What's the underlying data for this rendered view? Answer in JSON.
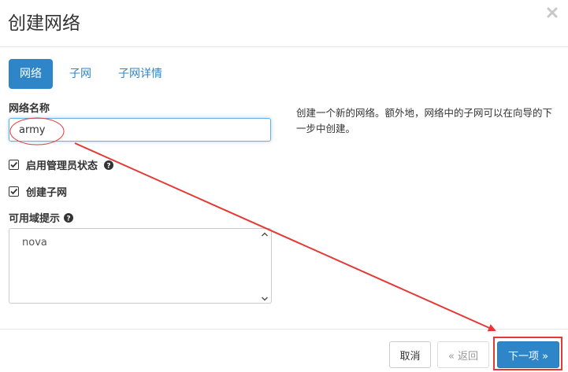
{
  "modal": {
    "title": "创建网络"
  },
  "tabs": [
    {
      "label": "网络",
      "active": true
    },
    {
      "label": "子网",
      "active": false
    },
    {
      "label": "子网详情",
      "active": false
    }
  ],
  "form": {
    "network_name_label": "网络名称",
    "network_name_value": "army",
    "admin_state_label": "启用管理员状态",
    "admin_state_checked": true,
    "create_subnet_label": "创建子网",
    "create_subnet_checked": true,
    "az_hints_label": "可用域提示",
    "az_options": [
      "nova"
    ]
  },
  "description": "创建一个新的网络。额外地，网络中的子网可以在向导的下一步中创建。",
  "footer": {
    "cancel_label": "取消",
    "back_label": "« 返回",
    "next_label": "下一项 »"
  },
  "colors": {
    "primary": "#2e86c8",
    "annotation": "#e53935"
  }
}
